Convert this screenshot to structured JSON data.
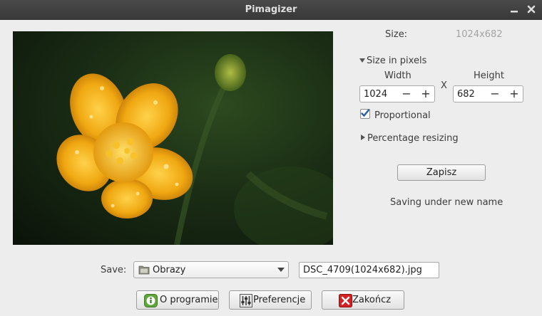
{
  "window": {
    "title": "Pimagizer"
  },
  "image": {
    "alt": ""
  },
  "size": {
    "label": "Size:",
    "value": "1024x682"
  },
  "pixels": {
    "expander_label": "Size in pixels",
    "width_label": "Width",
    "height_label": "Height",
    "separator": "X",
    "width_value": "1024",
    "height_value": "682"
  },
  "proportional": {
    "label": "Proportional",
    "checked": true
  },
  "percentage": {
    "expander_label": "Percentage resizing"
  },
  "save_button": {
    "label": "Zapisz"
  },
  "status": {
    "text": "Saving under new name"
  },
  "save_row": {
    "label": "Save:",
    "folder": "Obrazy",
    "filename": "DSC_4709(1024x682).jpg"
  },
  "footer": {
    "about_label": "O programie",
    "prefs_label": "Preferencje",
    "quit_label": "Zakończ"
  },
  "colors": {
    "titlebar": "#3f3f3f",
    "close_red": "#d32222",
    "info_green": "#5fa53a",
    "check": "#2d5da0"
  }
}
